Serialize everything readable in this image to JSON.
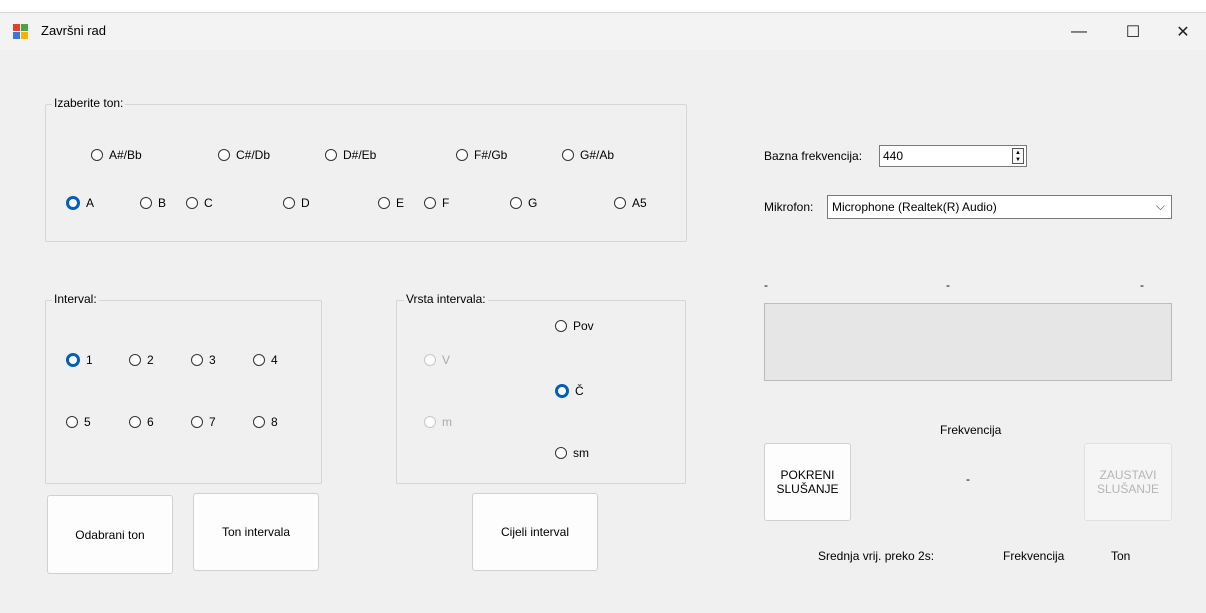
{
  "window": {
    "title": "Završni rad",
    "controls": {
      "minimize": "—",
      "maximize": "☐",
      "close": "✕"
    }
  },
  "ton_group": {
    "label": "Izaberite ton:",
    "row1": [
      {
        "label": "A#/Bb",
        "checked": false
      },
      {
        "label": "C#/Db",
        "checked": false
      },
      {
        "label": "D#/Eb",
        "checked": false
      },
      {
        "label": "F#/Gb",
        "checked": false
      },
      {
        "label": "G#/Ab",
        "checked": false
      }
    ],
    "row2": [
      {
        "label": "A",
        "checked": true
      },
      {
        "label": "B",
        "checked": false
      },
      {
        "label": "C",
        "checked": false
      },
      {
        "label": "D",
        "checked": false
      },
      {
        "label": "E",
        "checked": false
      },
      {
        "label": "F",
        "checked": false
      },
      {
        "label": "G",
        "checked": false
      },
      {
        "label": "A5",
        "checked": false
      }
    ]
  },
  "interval_group": {
    "label": "Interval:",
    "options": [
      {
        "label": "1",
        "checked": true
      },
      {
        "label": "2",
        "checked": false
      },
      {
        "label": "3",
        "checked": false
      },
      {
        "label": "4",
        "checked": false
      },
      {
        "label": "5",
        "checked": false
      },
      {
        "label": "6",
        "checked": false
      },
      {
        "label": "7",
        "checked": false
      },
      {
        "label": "8",
        "checked": false
      }
    ]
  },
  "vrsta_group": {
    "label": "Vrsta intervala:",
    "pov": "Pov",
    "v": "V",
    "c": "Č",
    "m": "m",
    "sm": "sm"
  },
  "buttons": {
    "odabrani_ton": "Odabrani ton",
    "ton_intervala": "Ton intervala",
    "cijeli_interval": "Cijeli interval",
    "pokreni": "POKRENI SLUŠANJE",
    "zaustavi": "ZAUSTAVI SLUŠANJE"
  },
  "settings": {
    "bazna_label": "Bazna frekvencija:",
    "bazna_value": "440",
    "mikrofon_label": "Mikrofon:",
    "mikrofon_value": "Microphone (Realtek(R) Audio)"
  },
  "indicators": {
    "left": "-",
    "mid": "-",
    "right": "-",
    "progress_value": 0,
    "frekvencija_label": "Frekvencija",
    "center_value": "-",
    "srednja_label": "Srednja vrij. preko 2s:",
    "bottom_freq": "Frekvencija",
    "bottom_ton": "Ton"
  },
  "colors": {
    "accent": "#005fb8",
    "disabled": "#aaaaaa",
    "background": "#f0f0f0"
  }
}
